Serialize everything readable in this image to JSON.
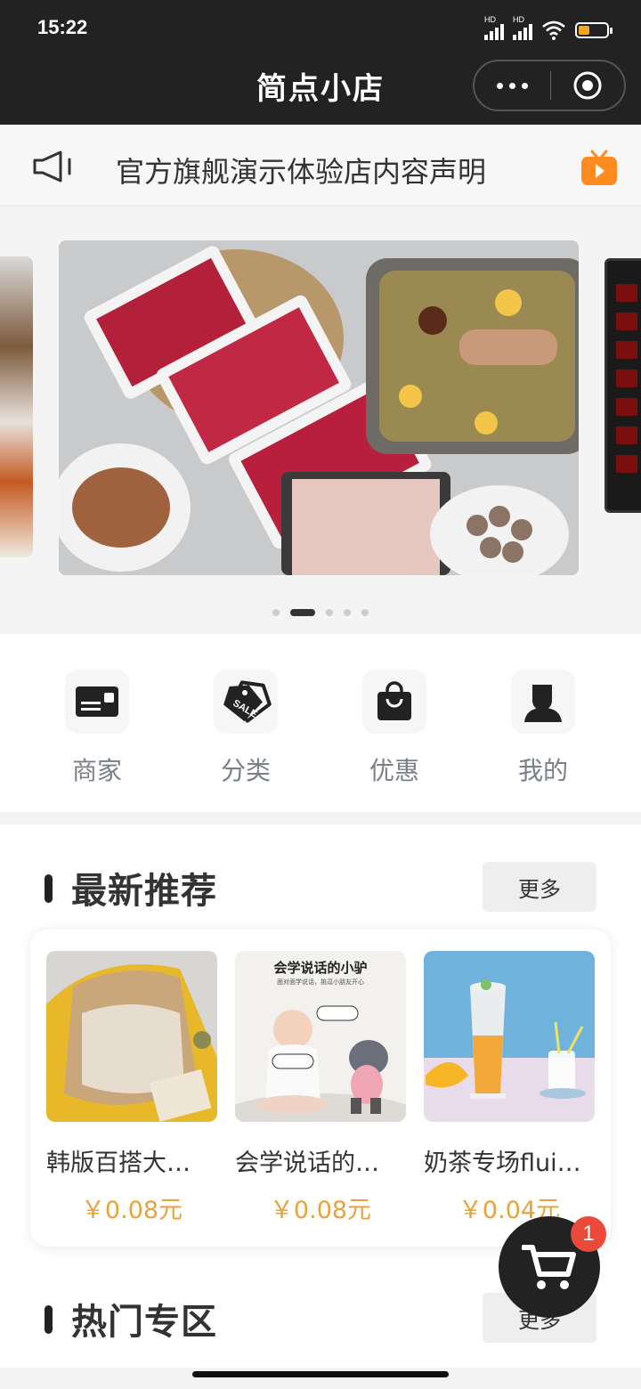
{
  "status_bar": {
    "time": "15:22",
    "signal_1_label": "HD",
    "signal_2_label": "HD",
    "battery_level": 0.4,
    "battery_color": "#f5a623"
  },
  "titlebar": {
    "title": "简点小店",
    "more_icon": "more-dots-icon",
    "close_icon": "record-circle-icon"
  },
  "notice": {
    "icon": "speaker-icon",
    "text": "官方旗舰演示体验店内容声明",
    "right_icon": "tv-icon",
    "right_icon_color": "#ff8a1f"
  },
  "banner": {
    "slides": 5,
    "active_index": 1
  },
  "categories": [
    {
      "label": "商家",
      "icon": "store-card-icon"
    },
    {
      "label": "分类",
      "icon": "sale-tag-icon"
    },
    {
      "label": "优惠",
      "icon": "shopping-bag-icon"
    },
    {
      "label": "我的",
      "icon": "user-icon"
    }
  ],
  "recommend": {
    "title": "最新推荐",
    "more_label": "更多",
    "products": [
      {
        "name": "韩版百搭大…",
        "price": "￥0.08元"
      },
      {
        "name": "会学说话的…",
        "price": "￥0.08元",
        "image_caption": "会学说话的小驴",
        "image_subcaption": "面对面学说话，挑逗小朋友开心"
      },
      {
        "name": "奶茶专场flui…",
        "price": "￥0.04元"
      }
    ]
  },
  "hot": {
    "title": "热门专区",
    "more_label": "更多"
  },
  "cart": {
    "icon": "cart-icon",
    "badge": "1",
    "badge_color": "#e94a3a"
  }
}
